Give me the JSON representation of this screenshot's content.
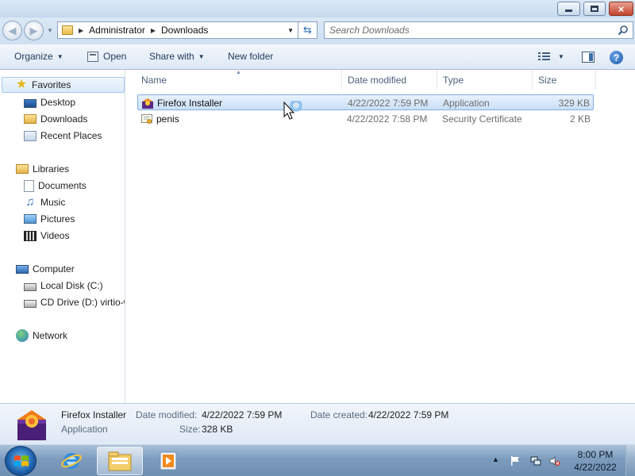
{
  "window": {
    "minimize_glyph": "",
    "close_glyph": "×"
  },
  "address": {
    "crumbs": [
      "Administrator",
      "Downloads"
    ],
    "search_placeholder": "Search Downloads"
  },
  "commandbar": {
    "organize": "Organize",
    "open": "Open",
    "share_with": "Share with",
    "new_folder": "New folder",
    "help": "?"
  },
  "navpane": {
    "favorites": {
      "label": "Favorites",
      "items": [
        "Desktop",
        "Downloads",
        "Recent Places"
      ]
    },
    "libraries": {
      "label": "Libraries",
      "items": [
        "Documents",
        "Music",
        "Pictures",
        "Videos"
      ]
    },
    "computer": {
      "label": "Computer",
      "items": [
        "Local Disk (C:)",
        "CD Drive (D:) virtio-w"
      ]
    },
    "network": {
      "label": "Network"
    }
  },
  "columns": {
    "name": "Name",
    "date_modified": "Date modified",
    "type": "Type",
    "size": "Size"
  },
  "files": [
    {
      "name": "Firefox Installer",
      "date_modified": "4/22/2022 7:59 PM",
      "type": "Application",
      "size": "329 KB",
      "selected": true,
      "icon": "firefox-installer-icon"
    },
    {
      "name": "penis",
      "date_modified": "4/22/2022 7:58 PM",
      "type": "Security Certificate",
      "size": "2 KB",
      "selected": false,
      "icon": "certificate-icon"
    }
  ],
  "details": {
    "name": "Firefox Installer",
    "type": "Application",
    "date_modified_label": "Date modified:",
    "date_modified": "4/22/2022 7:59 PM",
    "date_created_label": "Date created:",
    "date_created": "4/22/2022 7:59 PM",
    "size_label": "Size:",
    "size": "328 KB"
  },
  "taskbar": {
    "time": "8:00 PM",
    "date": "4/22/2022"
  },
  "colors": {
    "selection": "#c9e0f7",
    "selection_border": "#84acdd",
    "command_text": "#1e395b",
    "taskbar": "#7c9bbd"
  }
}
